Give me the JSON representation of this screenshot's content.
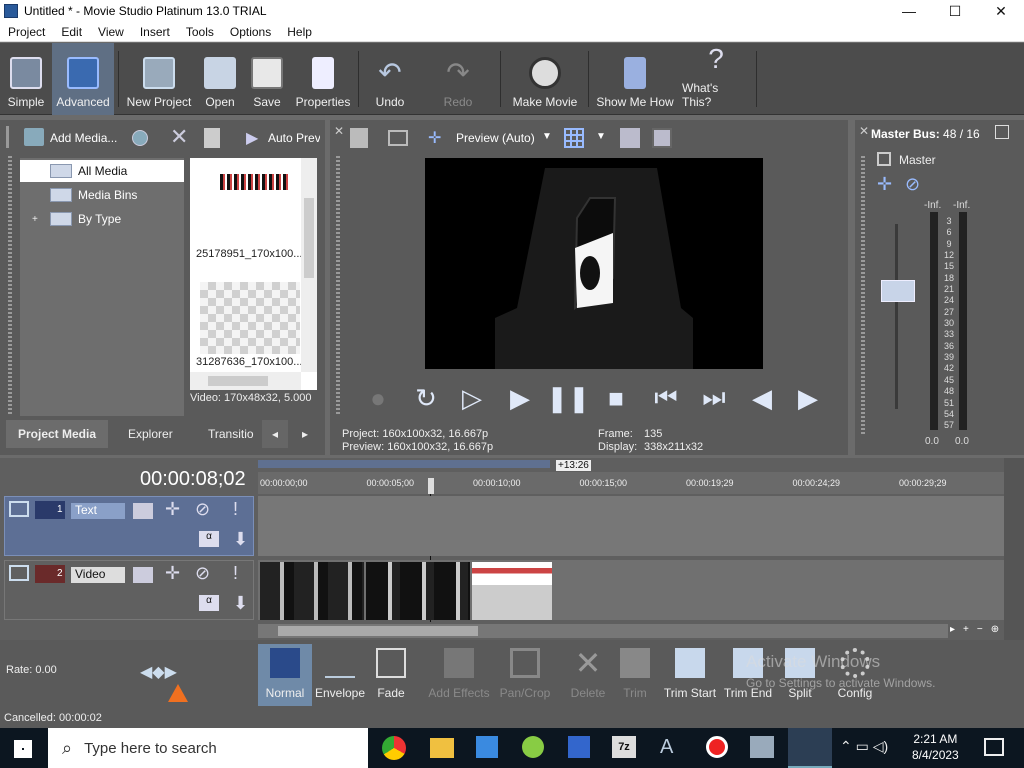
{
  "window": {
    "title": "Untitled * - Movie Studio Platinum 13.0 TRIAL"
  },
  "menu": [
    "Project",
    "Edit",
    "View",
    "Insert",
    "Tools",
    "Options",
    "Help"
  ],
  "toolbar": {
    "simple": "Simple",
    "advanced": "Advanced",
    "new_project": "New Project",
    "open": "Open",
    "save": "Save",
    "properties": "Properties",
    "undo": "Undo",
    "redo": "Redo",
    "make_movie": "Make Movie",
    "show_me_how": "Show Me How",
    "whats_this": "What's This?"
  },
  "media": {
    "add_media": "Add Media...",
    "auto_preview": "Auto Prev",
    "tree": [
      "All Media",
      "Media Bins",
      "By Type"
    ],
    "thumbs": [
      "25178951_170x100...",
      "31287636_170x100..."
    ],
    "info": "Video: 170x48x32, 5.000",
    "tabs": [
      "Project Media",
      "Explorer",
      "Transitio"
    ]
  },
  "preview": {
    "mode": "Preview (Auto)",
    "project_label": "Project:",
    "project_value": "160x100x32, 16.667p",
    "preview_label": "Preview:",
    "preview_value": "160x100x32, 16.667p",
    "frame_label": "Frame:",
    "frame_value": "135",
    "display_label": "Display:",
    "display_value": "338x211x32"
  },
  "master": {
    "title": "Master Bus:",
    "count": "48 / 16",
    "label": "Master",
    "inf_l": "-Inf.",
    "inf_r": "-Inf.",
    "scale": [
      "3",
      "6",
      "9",
      "12",
      "15",
      "18",
      "21",
      "24",
      "27",
      "30",
      "33",
      "36",
      "39",
      "42",
      "45",
      "48",
      "51",
      "54",
      "57"
    ],
    "zero_l": "0.0",
    "zero_r": "0.0"
  },
  "timeline": {
    "time": "00:00:08;02",
    "region": "+13:26",
    "ruler": [
      "00:00:00;00",
      "00:00:05;00",
      "00:00:10;00",
      "00:00:15;00",
      "00:00:19;29",
      "00:00:24;29",
      "00:00:29;29"
    ],
    "tracks": [
      {
        "num": "1",
        "name": "Text"
      },
      {
        "num": "2",
        "name": "Video"
      }
    ]
  },
  "edit": {
    "rate": "Rate: 0.00",
    "tools": [
      "Normal",
      "Envelope",
      "Fade",
      "Add Effects",
      "Pan/Crop",
      "Delete",
      "Trim",
      "Trim Start",
      "Trim End",
      "Split",
      "Config"
    ],
    "watermark1": "Activate Windows",
    "watermark2": "Go to Settings to activate Windows."
  },
  "status": "Cancelled: 00:00:02",
  "taskbar": {
    "search": "Type here to search",
    "time": "2:21 AM",
    "date": "8/4/2023"
  },
  "colors": {
    "accent": "#5f6f84",
    "track_text": "#5d6f95",
    "taskbar": "#0c1620"
  }
}
